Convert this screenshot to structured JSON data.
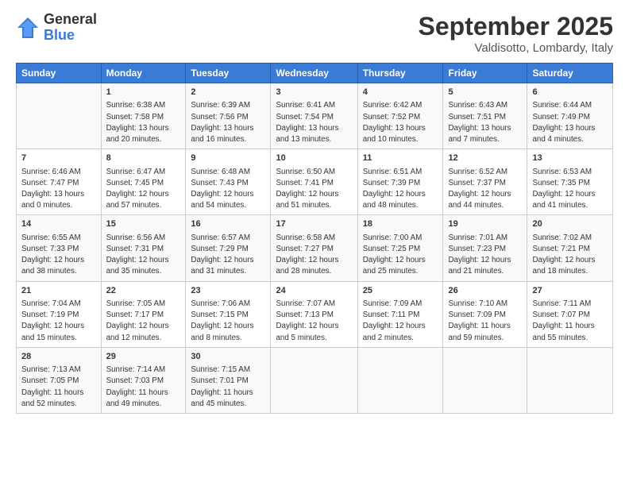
{
  "logo": {
    "general": "General",
    "blue": "Blue"
  },
  "title": "September 2025",
  "location": "Valdisotto, Lombardy, Italy",
  "weekdays": [
    "Sunday",
    "Monday",
    "Tuesday",
    "Wednesday",
    "Thursday",
    "Friday",
    "Saturday"
  ],
  "weeks": [
    [
      {
        "day": "",
        "sunrise": "",
        "sunset": "",
        "daylight": ""
      },
      {
        "day": "1",
        "sunrise": "Sunrise: 6:38 AM",
        "sunset": "Sunset: 7:58 PM",
        "daylight": "Daylight: 13 hours and 20 minutes."
      },
      {
        "day": "2",
        "sunrise": "Sunrise: 6:39 AM",
        "sunset": "Sunset: 7:56 PM",
        "daylight": "Daylight: 13 hours and 16 minutes."
      },
      {
        "day": "3",
        "sunrise": "Sunrise: 6:41 AM",
        "sunset": "Sunset: 7:54 PM",
        "daylight": "Daylight: 13 hours and 13 minutes."
      },
      {
        "day": "4",
        "sunrise": "Sunrise: 6:42 AM",
        "sunset": "Sunset: 7:52 PM",
        "daylight": "Daylight: 13 hours and 10 minutes."
      },
      {
        "day": "5",
        "sunrise": "Sunrise: 6:43 AM",
        "sunset": "Sunset: 7:51 PM",
        "daylight": "Daylight: 13 hours and 7 minutes."
      },
      {
        "day": "6",
        "sunrise": "Sunrise: 6:44 AM",
        "sunset": "Sunset: 7:49 PM",
        "daylight": "Daylight: 13 hours and 4 minutes."
      }
    ],
    [
      {
        "day": "7",
        "sunrise": "Sunrise: 6:46 AM",
        "sunset": "Sunset: 7:47 PM",
        "daylight": "Daylight: 13 hours and 0 minutes."
      },
      {
        "day": "8",
        "sunrise": "Sunrise: 6:47 AM",
        "sunset": "Sunset: 7:45 PM",
        "daylight": "Daylight: 12 hours and 57 minutes."
      },
      {
        "day": "9",
        "sunrise": "Sunrise: 6:48 AM",
        "sunset": "Sunset: 7:43 PM",
        "daylight": "Daylight: 12 hours and 54 minutes."
      },
      {
        "day": "10",
        "sunrise": "Sunrise: 6:50 AM",
        "sunset": "Sunset: 7:41 PM",
        "daylight": "Daylight: 12 hours and 51 minutes."
      },
      {
        "day": "11",
        "sunrise": "Sunrise: 6:51 AM",
        "sunset": "Sunset: 7:39 PM",
        "daylight": "Daylight: 12 hours and 48 minutes."
      },
      {
        "day": "12",
        "sunrise": "Sunrise: 6:52 AM",
        "sunset": "Sunset: 7:37 PM",
        "daylight": "Daylight: 12 hours and 44 minutes."
      },
      {
        "day": "13",
        "sunrise": "Sunrise: 6:53 AM",
        "sunset": "Sunset: 7:35 PM",
        "daylight": "Daylight: 12 hours and 41 minutes."
      }
    ],
    [
      {
        "day": "14",
        "sunrise": "Sunrise: 6:55 AM",
        "sunset": "Sunset: 7:33 PM",
        "daylight": "Daylight: 12 hours and 38 minutes."
      },
      {
        "day": "15",
        "sunrise": "Sunrise: 6:56 AM",
        "sunset": "Sunset: 7:31 PM",
        "daylight": "Daylight: 12 hours and 35 minutes."
      },
      {
        "day": "16",
        "sunrise": "Sunrise: 6:57 AM",
        "sunset": "Sunset: 7:29 PM",
        "daylight": "Daylight: 12 hours and 31 minutes."
      },
      {
        "day": "17",
        "sunrise": "Sunrise: 6:58 AM",
        "sunset": "Sunset: 7:27 PM",
        "daylight": "Daylight: 12 hours and 28 minutes."
      },
      {
        "day": "18",
        "sunrise": "Sunrise: 7:00 AM",
        "sunset": "Sunset: 7:25 PM",
        "daylight": "Daylight: 12 hours and 25 minutes."
      },
      {
        "day": "19",
        "sunrise": "Sunrise: 7:01 AM",
        "sunset": "Sunset: 7:23 PM",
        "daylight": "Daylight: 12 hours and 21 minutes."
      },
      {
        "day": "20",
        "sunrise": "Sunrise: 7:02 AM",
        "sunset": "Sunset: 7:21 PM",
        "daylight": "Daylight: 12 hours and 18 minutes."
      }
    ],
    [
      {
        "day": "21",
        "sunrise": "Sunrise: 7:04 AM",
        "sunset": "Sunset: 7:19 PM",
        "daylight": "Daylight: 12 hours and 15 minutes."
      },
      {
        "day": "22",
        "sunrise": "Sunrise: 7:05 AM",
        "sunset": "Sunset: 7:17 PM",
        "daylight": "Daylight: 12 hours and 12 minutes."
      },
      {
        "day": "23",
        "sunrise": "Sunrise: 7:06 AM",
        "sunset": "Sunset: 7:15 PM",
        "daylight": "Daylight: 12 hours and 8 minutes."
      },
      {
        "day": "24",
        "sunrise": "Sunrise: 7:07 AM",
        "sunset": "Sunset: 7:13 PM",
        "daylight": "Daylight: 12 hours and 5 minutes."
      },
      {
        "day": "25",
        "sunrise": "Sunrise: 7:09 AM",
        "sunset": "Sunset: 7:11 PM",
        "daylight": "Daylight: 12 hours and 2 minutes."
      },
      {
        "day": "26",
        "sunrise": "Sunrise: 7:10 AM",
        "sunset": "Sunset: 7:09 PM",
        "daylight": "Daylight: 11 hours and 59 minutes."
      },
      {
        "day": "27",
        "sunrise": "Sunrise: 7:11 AM",
        "sunset": "Sunset: 7:07 PM",
        "daylight": "Daylight: 11 hours and 55 minutes."
      }
    ],
    [
      {
        "day": "28",
        "sunrise": "Sunrise: 7:13 AM",
        "sunset": "Sunset: 7:05 PM",
        "daylight": "Daylight: 11 hours and 52 minutes."
      },
      {
        "day": "29",
        "sunrise": "Sunrise: 7:14 AM",
        "sunset": "Sunset: 7:03 PM",
        "daylight": "Daylight: 11 hours and 49 minutes."
      },
      {
        "day": "30",
        "sunrise": "Sunrise: 7:15 AM",
        "sunset": "Sunset: 7:01 PM",
        "daylight": "Daylight: 11 hours and 45 minutes."
      },
      {
        "day": "",
        "sunrise": "",
        "sunset": "",
        "daylight": ""
      },
      {
        "day": "",
        "sunrise": "",
        "sunset": "",
        "daylight": ""
      },
      {
        "day": "",
        "sunrise": "",
        "sunset": "",
        "daylight": ""
      },
      {
        "day": "",
        "sunrise": "",
        "sunset": "",
        "daylight": ""
      }
    ]
  ]
}
